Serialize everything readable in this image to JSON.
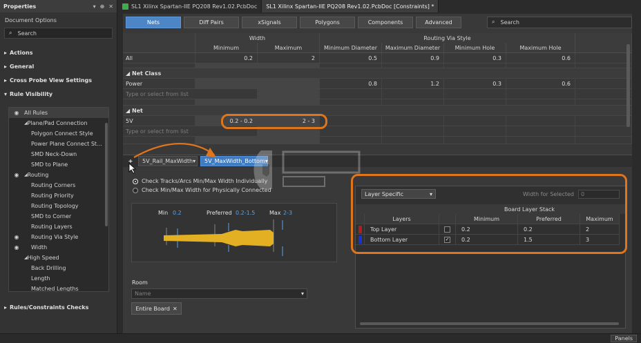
{
  "left_panel": {
    "title": "Properties",
    "doc_options": "Document Options",
    "search_placeholder": "Search",
    "sections": {
      "actions": "Actions",
      "general": "General",
      "cross_probe": "Cross Probe View Settings",
      "rule_visibility": "Rule Visibility",
      "rules_checks": "Rules/Constraints Checks"
    },
    "rules": [
      {
        "label": "All Rules",
        "indent": 0,
        "eye": true,
        "arrow": false
      },
      {
        "label": "Plane/Pad Connection",
        "indent": 1,
        "eye": false,
        "arrow": true
      },
      {
        "label": "Polygon Connect Style",
        "indent": 2,
        "eye": false,
        "arrow": false
      },
      {
        "label": "Power Plane Connect St...",
        "indent": 2,
        "eye": false,
        "arrow": false
      },
      {
        "label": "SMD Neck-Down",
        "indent": 2,
        "eye": false,
        "arrow": false
      },
      {
        "label": "SMD to Plane",
        "indent": 2,
        "eye": false,
        "arrow": false
      },
      {
        "label": "Routing",
        "indent": 1,
        "eye": true,
        "arrow": true
      },
      {
        "label": "Routing Corners",
        "indent": 2,
        "eye": false,
        "arrow": false
      },
      {
        "label": "Routing Priority",
        "indent": 2,
        "eye": false,
        "arrow": false
      },
      {
        "label": "Routing Topology",
        "indent": 2,
        "eye": false,
        "arrow": false
      },
      {
        "label": "SMD to Corner",
        "indent": 2,
        "eye": false,
        "arrow": false
      },
      {
        "label": "Routing Layers",
        "indent": 2,
        "eye": false,
        "arrow": false
      },
      {
        "label": "Routing Via Style",
        "indent": 2,
        "eye": true,
        "arrow": false
      },
      {
        "label": "Width",
        "indent": 2,
        "eye": true,
        "arrow": false
      },
      {
        "label": "High Speed",
        "indent": 1,
        "eye": false,
        "arrow": true
      },
      {
        "label": "Back Drilling",
        "indent": 2,
        "eye": false,
        "arrow": false
      },
      {
        "label": "Length",
        "indent": 2,
        "eye": false,
        "arrow": false
      },
      {
        "label": "Matched Lengths",
        "indent": 2,
        "eye": false,
        "arrow": false
      }
    ]
  },
  "doc_tabs": [
    {
      "label": "SL1 Xilinx Spartan-IIE PQ208 Rev1.02.PcbDoc",
      "active": false
    },
    {
      "label": "SL1 Xilinx Spartan-IIE PQ208 Rev1.02.PcbDoc [Constraints] *",
      "active": true
    }
  ],
  "toolbar": {
    "buttons": [
      "Nets",
      "Diff Pairs",
      "xSignals",
      "Polygons",
      "Components",
      "Advanced"
    ],
    "search_placeholder": "Search"
  },
  "grid": {
    "group_headers": {
      "width": "Width",
      "via": "Routing Via Style"
    },
    "columns": [
      "Minimum",
      "Maximum",
      "Minimum Diameter",
      "Maximum Diameter",
      "Minimum Hole",
      "Maximum Hole"
    ],
    "all_row": {
      "label": "All",
      "values": [
        "0.2",
        "2",
        "0.5",
        "0.9",
        "0.3",
        "0.6"
      ]
    },
    "net_class": {
      "title": "Net Class",
      "row_label": "Power",
      "values": [
        "",
        "",
        "0.8",
        "1.2",
        "0.3",
        "0.6"
      ],
      "placeholder": "Type or select from list"
    },
    "net": {
      "title": "Net",
      "row_label": "5V",
      "values": [
        "0.2 - 0.2",
        "2 - 3",
        "",
        "",
        "",
        ""
      ],
      "placeholder": "Type or select from list"
    }
  },
  "editor": {
    "plus": "+",
    "tabs": [
      {
        "label": "5V_Rail_MaxWidth",
        "active": false
      },
      {
        "label": "5V_MaxWidth_Bottom",
        "active": true
      }
    ],
    "radio1": "Check Tracks/Arcs Min/Max Width Individually",
    "radio2": "Check Min/Max Width for Physically Connected",
    "diagram": {
      "min_label": "Min",
      "min_val": "0.2",
      "pref_label": "Preferred",
      "pref_val": "0.2-1.5",
      "max_label": "Max",
      "max_val": "2-3"
    },
    "room_label": "Room",
    "room_placeholder": "Name",
    "entire_board": "Entire Board",
    "layer_select": "Layer Specific",
    "width_for_selected": "Width for Selected",
    "width_for_selected_val": "0",
    "board_layer_stack": "Board Layer Stack",
    "layer_headers": [
      "Layers",
      "Minimum",
      "Preferred",
      "Maximum"
    ],
    "layers": [
      {
        "name": "Top Layer",
        "color": "#b51c1c",
        "checked": false,
        "min": "0.2",
        "pref": "0.2",
        "max": "2"
      },
      {
        "name": "Bottom Layer",
        "color": "#1b32d4",
        "checked": true,
        "min": "0.2",
        "pref": "1.5",
        "max": "3"
      }
    ]
  },
  "status": {
    "panels": "Panels"
  },
  "colors": {
    "accent": "#4c86c7",
    "highlight": "#e0751b",
    "track": "#e3b024"
  }
}
